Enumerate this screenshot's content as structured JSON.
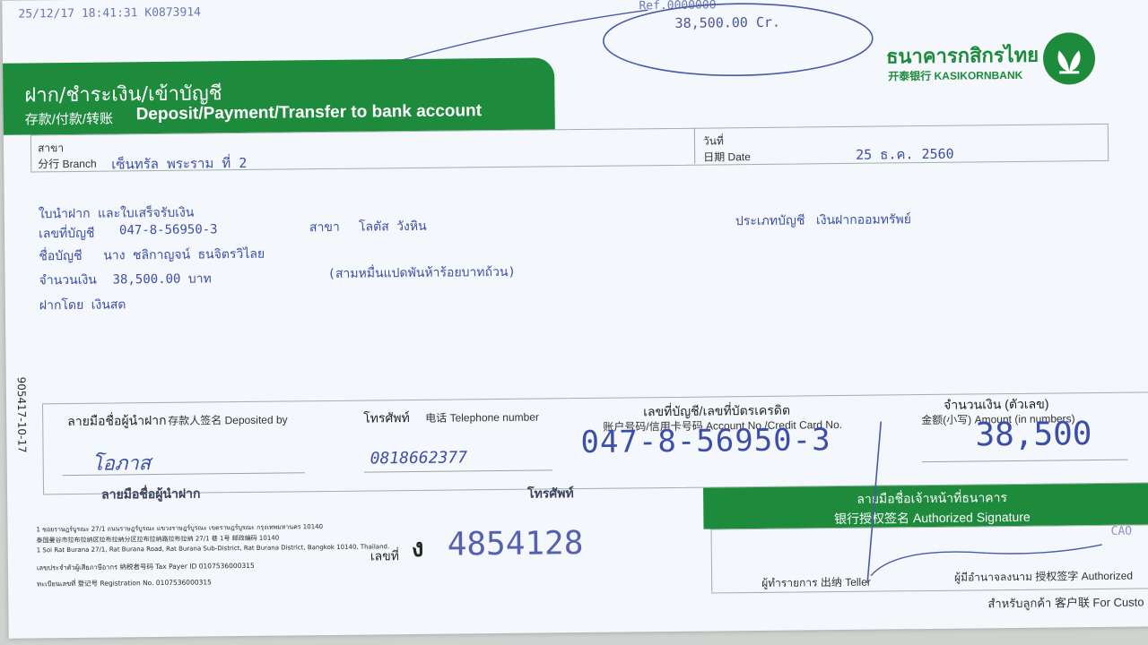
{
  "top": {
    "stamp": "25/12/17 18:41:31 K0873914",
    "ref_top": "Ref.0000000",
    "ref_amount": "38,500.00 Cr."
  },
  "bank": {
    "name_th": "ธนาคารกสิกรไทย",
    "name_cn_en": "开泰银行 KASIKORNBANK"
  },
  "header": {
    "title_th": "ฝาก/ชำระเงิน/เข้าบัญชี",
    "title_cn": "存款/付款/转账",
    "title_en": "Deposit/Payment/Transfer to bank account"
  },
  "branch": {
    "label_th": "สาขา",
    "label_en": "分行 Branch",
    "value": "เซ็นทรัล พระราม ที่ 2"
  },
  "date": {
    "label_th": "วันที่",
    "label_en": "日期 Date",
    "value": "25 ธ.ค. 2560"
  },
  "body": {
    "line1": "ใบนำฝาก และใบเสร็จรับเงิน",
    "account_label": "เลขที่บัญชี",
    "account_value": "047-8-56950-3",
    "branch_label": "สาขา",
    "branch_value": "โลตัส วังหิน",
    "type_label": "ประเภทบัญชี",
    "type_value": "เงินฝากออมทรัพย์",
    "name_label": "ชื่อบัญชี",
    "name_value": "นาง ชลิกาญจน์ ธนจิตรวิไลย",
    "amount_label": "จำนวนเงิน",
    "amount_value": "38,500.00 บาท",
    "amount_words": "(สามหมื่นแปดพันห้าร้อยบาทถ้วน)",
    "deposit_type": "ฝากโดย เงินสด"
  },
  "footer": {
    "side_code": "905417-10-17",
    "deposited_th": "ลายมือชื่อผู้นำฝาก",
    "deposited_cn_en": "存款人签名 Deposited by",
    "deposited_sig": "โอภาส",
    "deposited_under": "ลายมือชื่อผู้นำฝาก",
    "phone_th": "โทรศัพท์",
    "phone_cn_en": "电话 Telephone number",
    "phone_value": "0818662377",
    "phone_under": "โทรศัพท์",
    "acct_th": "เลขที่บัญชี/เลขที่บัตรเครดิต",
    "acct_cn_en": "账户号码/信用卡号码 Account No./Credit Card No.",
    "acct_value": "047-8-56950-3",
    "amt_th": "จำนวนเงิน (ตัวเลข)",
    "amt_cn_en": "金额(小写) Amount (in numbers)",
    "amt_value": "38,500",
    "addr1": "1 ซอยราษฎร์บูรณะ 27/1 ถนนราษฎร์บูรณะ แขวงราษฎร์บูรณะ เขตราษฎร์บูรณะ กรุงเทพมหานคร 10140",
    "addr2": "泰国曼谷市拉布拉纳区拉布拉纳分区拉布拉纳路拉布拉纳 27/1 巷 1号 邮政编码 10140",
    "addr3": "1 Soi Rat Burana 27/1, Rat Burana Road, Rat Burana Sub-District, Rat Burana District, Bangkok 10140, Thailand.",
    "tax": "เลขประจำตัวผู้เสียภาษีอากร 纳税者号码 Tax Payer ID 0107536000315",
    "reg": "ทะเบียนเลขที่ 登记号 Registration No. 0107536000315",
    "no_label": "เลขที่",
    "no_prefix": "ง",
    "no_value": "4854128",
    "auth_th": "ลายมือชื่อเจ้าหน้าที่ธนาคาร",
    "auth_cn_en": "银行授权签名 Authorized Signature",
    "teller": "ผู้ทำรายการ 出纳 Teller",
    "authorized": "ผู้มีอำนาจลงนาม 授权签字 Authorized",
    "customer": "สำหรับลูกค้า 客户联 For Custo",
    "cao": "CAO"
  },
  "colors": {
    "brand_green": "#1d8a3c",
    "ink_blue": "#3c4fa8"
  }
}
